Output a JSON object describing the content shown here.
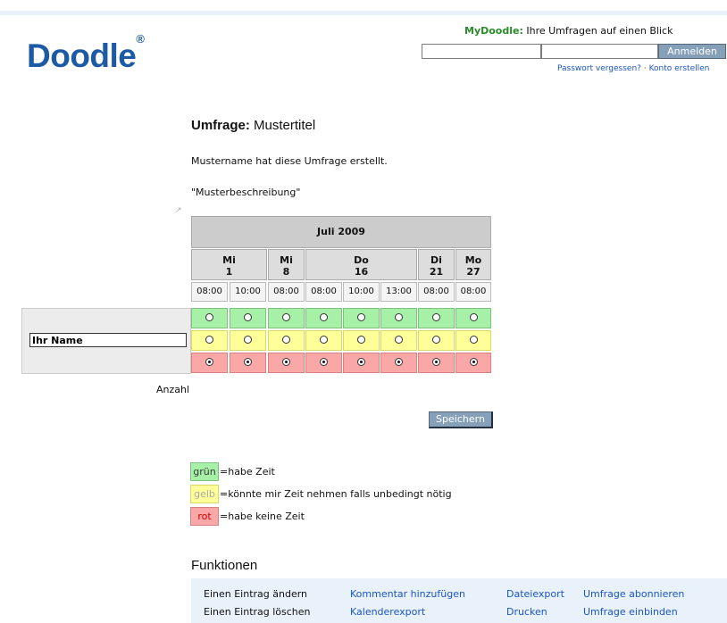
{
  "brand": {
    "logo": "Doodle",
    "logo_mark": "®"
  },
  "header": {
    "mydoodle_label": "MyDoodle:",
    "mydoodle_text": "Ihre Umfragen auf einen Blick",
    "login_button": "Anmelden",
    "forgot_password": "Passwort vergessen?",
    "separator": "·",
    "create_account": "Konto erstellen"
  },
  "poll": {
    "title_label": "Umfrage:",
    "title": "Mustertitel",
    "creator_line": "Mustername hat diese Umfrage erstellt.",
    "description": "\"Musterbeschreibung\"",
    "month": "Juli 2009",
    "days": [
      {
        "wd": "Mi",
        "d": "1"
      },
      {
        "wd": "Mi",
        "d": "8"
      },
      {
        "wd": "Do",
        "d": "16"
      },
      {
        "wd": "Di",
        "d": "21"
      },
      {
        "wd": "Mo",
        "d": "27"
      }
    ],
    "times": [
      "08:00",
      "10:00",
      "08:00",
      "08:00",
      "10:00",
      "13:00",
      "08:00",
      "08:00"
    ],
    "name_value": "Ihr Name",
    "count_label": "Anzahl",
    "save_button": "Speichern"
  },
  "legend": [
    {
      "swatch": "grün",
      "text": "=habe Zeit"
    },
    {
      "swatch": "gelb",
      "text": "=könnte mir Zeit nehmen falls unbedingt nötig"
    },
    {
      "swatch": "rot",
      "text": "=habe keine Zeit"
    }
  ],
  "functions": {
    "title": "Funktionen",
    "edit_entry": "Einen Eintrag ändern",
    "delete_entry": "Einen Eintrag löschen",
    "add_comment": "Kommentar hinzufügen",
    "calendar_export": "Kalenderexport",
    "file_export": "Dateiexport",
    "print": "Drucken",
    "subscribe": "Umfrage abonnieren",
    "embed": "Umfrage einbinden"
  },
  "colors": {
    "yes": "#a7f0a7",
    "maybe": "#ffff99",
    "no": "#f9a7a7",
    "brand": "#1c5aa6"
  }
}
